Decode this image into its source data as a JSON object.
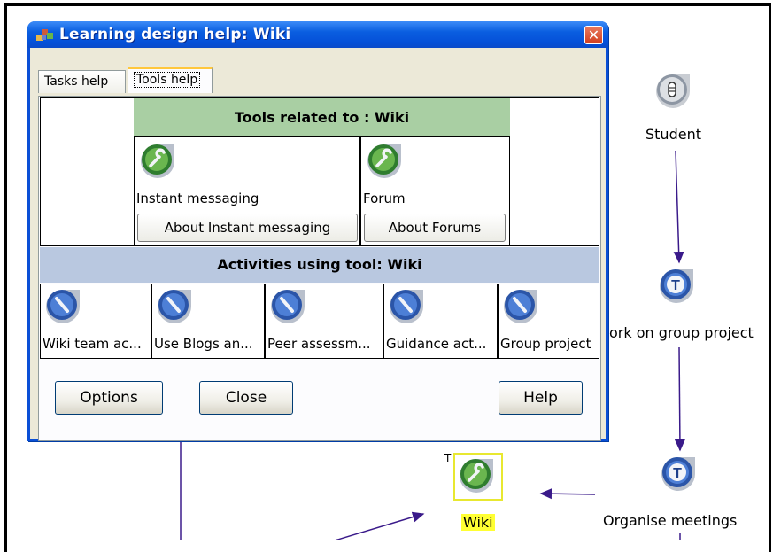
{
  "dialog": {
    "title": "Learning design help: Wiki",
    "close_glyph": "✕",
    "tabs": [
      {
        "label": "Tasks help",
        "selected": false
      },
      {
        "label": "Tools help",
        "selected": true
      }
    ],
    "tools_header": "Tools related to :  Wiki",
    "tools": [
      {
        "name": "Instant messaging",
        "button": "About Instant messaging",
        "icon": "tool-wrench-icon"
      },
      {
        "name": "Forum",
        "button": "About Forums",
        "icon": "tool-wrench-icon"
      }
    ],
    "activities_header": "Activities using tool:  Wiki",
    "activities": [
      {
        "name": "Wiki team ac...",
        "icon": "task-pencil-icon"
      },
      {
        "name": "Use Blogs an...",
        "icon": "task-pencil-icon"
      },
      {
        "name": "Peer assessm...",
        "icon": "task-pencil-icon"
      },
      {
        "name": "Guidance act...",
        "icon": "task-pencil-icon"
      },
      {
        "name": "Group project",
        "icon": "task-pencil-icon"
      }
    ],
    "buttons": {
      "options": "Options",
      "close": "Close",
      "help": "Help"
    }
  },
  "diagram": {
    "nodes": [
      {
        "id": "student",
        "label": "Student",
        "icon": "role-student-icon"
      },
      {
        "id": "work",
        "label": "ork on group project",
        "icon": "task-t-icon"
      },
      {
        "id": "wiki",
        "label": "Wiki",
        "prefix": "T",
        "icon": "tool-wrench-icon",
        "selected": true
      },
      {
        "id": "organise",
        "label": "Organise meetings",
        "icon": "task-t-icon"
      }
    ]
  },
  "colors": {
    "titlebar": "#0a5ee0",
    "tools_header_bg": "#a9cfa3",
    "activities_header_bg": "#b9c8e0",
    "edge": "#3a1a8a",
    "wiki_highlight": "#ffff33"
  }
}
